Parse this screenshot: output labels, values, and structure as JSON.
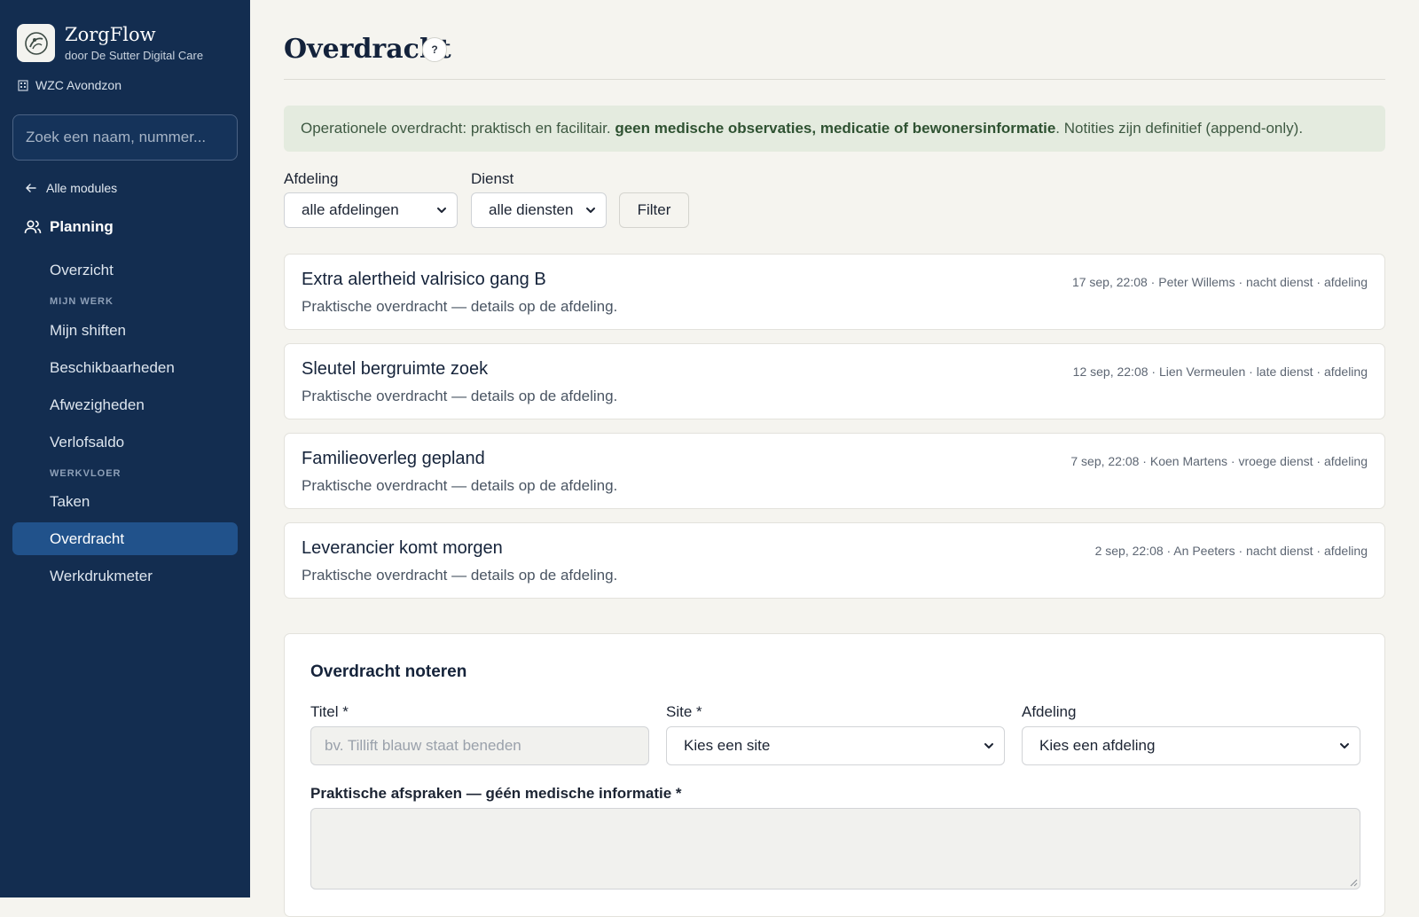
{
  "brand": {
    "name": "ZorgFlow",
    "subtitle": "door De Sutter Digital Care"
  },
  "site": {
    "name": "WZC Avondzon"
  },
  "search": {
    "placeholder": "Zoek een naam, nummer..."
  },
  "sidebar": {
    "back_label": "Alle modules",
    "module_label": "Planning",
    "items": [
      {
        "label": "Overzicht"
      },
      {
        "label": "Mijn shiften"
      },
      {
        "label": "Beschikbaarheden"
      },
      {
        "label": "Afwezigheden"
      },
      {
        "label": "Verlofsaldo"
      },
      {
        "label": "Taken"
      },
      {
        "label": "Overdracht",
        "active": true
      },
      {
        "label": "Werkdrukmeter"
      }
    ],
    "sections": [
      {
        "label": "MIJN WERK"
      },
      {
        "label": "WERKVLOER"
      }
    ]
  },
  "page": {
    "title": "Overdracht",
    "help_label": "?"
  },
  "notice": {
    "prefix": "Operationele overdracht: praktisch en facilitair. ",
    "bold": "geen medische observaties, medicatie of bewonersinformatie",
    "suffix": ". Notities zijn definitief (append-only)."
  },
  "filters": {
    "afdeling_label": "Afdeling",
    "afdeling_value": "alle afdelingen",
    "dienst_label": "Dienst",
    "dienst_value": "alle diensten",
    "button_label": "Filter"
  },
  "handovers": [
    {
      "title": "Extra alertheid valrisico gang B",
      "subtitle": "Praktische overdracht — details op de afdeling.",
      "meta": "17 sep, 22:08 · Peter Willems · nacht dienst · afdeling"
    },
    {
      "title": "Sleutel bergruimte zoek",
      "subtitle": "Praktische overdracht — details op de afdeling.",
      "meta": "12 sep, 22:08 · Lien Vermeulen · late dienst · afdeling"
    },
    {
      "title": "Familieoverleg gepland",
      "subtitle": "Praktische overdracht — details op de afdeling.",
      "meta": "7 sep, 22:08 · Koen Martens · vroege dienst · afdeling"
    },
    {
      "title": "Leverancier komt morgen",
      "subtitle": "Praktische overdracht — details op de afdeling.",
      "meta": "2 sep, 22:08 · An Peeters · nacht dienst · afdeling"
    }
  ],
  "form": {
    "title": "Overdracht noteren",
    "titel_label": "Titel *",
    "titel_placeholder": "bv. Tillift blauw staat beneden",
    "site_label": "Site *",
    "site_value": "Kies een site",
    "afdeling_label": "Afdeling",
    "afdeling_value": "Kies een afdeling",
    "notes_label": "Praktische afspraken — géén medische informatie *"
  },
  "colors": {
    "sidebar_bg": "#132d50",
    "active_item_bg": "#21528b",
    "notice_bg": "#e4ebdf",
    "page_bg": "#f5f4ef"
  }
}
